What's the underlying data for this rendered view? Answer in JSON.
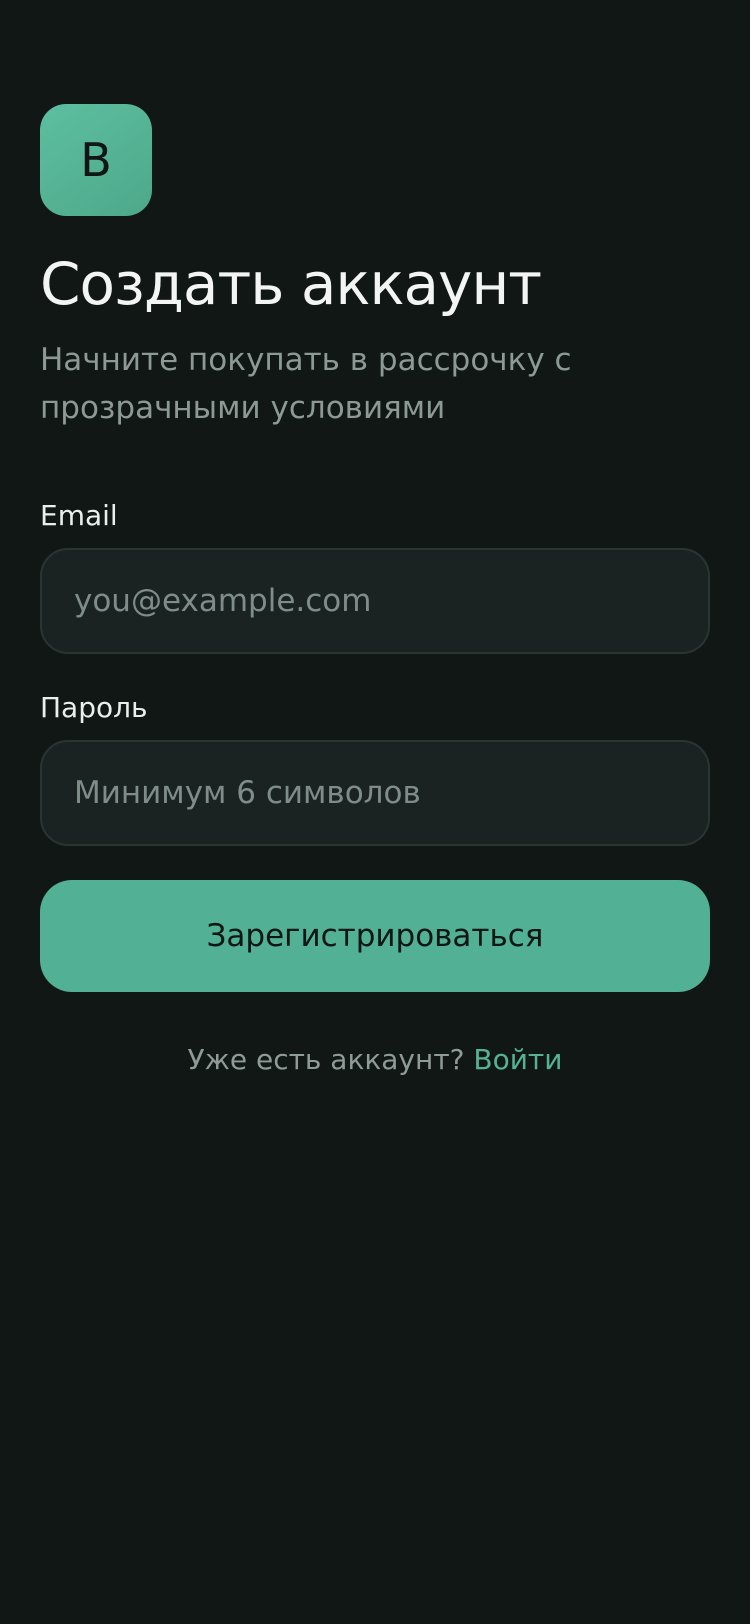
{
  "brand": {
    "logo_letter": "B"
  },
  "header": {
    "title": "Создать аккаунт",
    "subtitle": "Начните покупать в рассрочку с прозрачными условиями"
  },
  "form": {
    "email": {
      "label": "Email",
      "placeholder": "you@example.com",
      "value": ""
    },
    "password": {
      "label": "Пароль",
      "placeholder": "Минимум 6 символов",
      "value": ""
    },
    "submit_label": "Зарегистрироваться"
  },
  "footer": {
    "question": "Уже есть аккаунт? ",
    "login_link": "Войти"
  },
  "colors": {
    "background": "#101715",
    "accent": "#52b094",
    "field_bg": "#1a2321",
    "field_border": "#2a3532",
    "muted_text": "#8c9995"
  }
}
